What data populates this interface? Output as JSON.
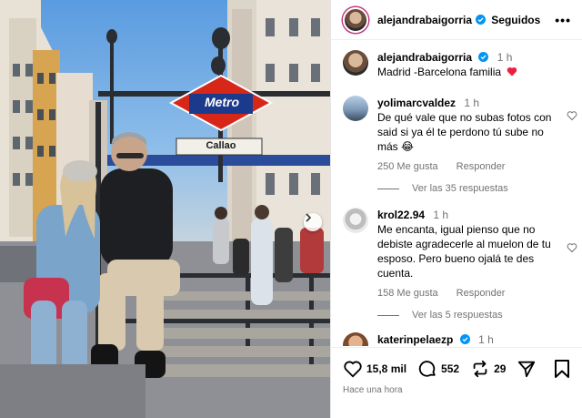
{
  "post": {
    "photo_alt_signs": {
      "metro": "Metro",
      "station": "Callao"
    }
  },
  "header": {
    "username": "alejandrabaigorria",
    "follow_label": "Seguidos",
    "more_label": "•••"
  },
  "caption": {
    "username": "alejandrabaigorria",
    "time": "1 h",
    "text": "Madrid -Barcelona  familia"
  },
  "comments": [
    {
      "username": "yolimarcvaldez",
      "time": "1 h",
      "text": "De qué vale que no subas fotos con said si ya él te perdono tú sube no más 😂",
      "likes": "250 Me gusta",
      "reply": "Responder",
      "replies": "Ver las 35 respuestas"
    },
    {
      "username": "krol22.94",
      "time": "1 h",
      "text": "Me encanta, igual pienso que no debiste agradecerle al muelon de tu esposo. Pero bueno ojalá te des cuenta.",
      "likes": "158 Me gusta",
      "reply": "Responder",
      "replies": "Ver las 5 respuestas"
    },
    {
      "username": "katerinpelaezp",
      "time": "1 h"
    }
  ],
  "actions": {
    "likes": "15,8 mil",
    "comments": "552",
    "reposts": "29",
    "posted_ago": "Hace una hora"
  },
  "colors": {
    "verified": "#0095f6",
    "heart_red": "#ed1f3e",
    "metro_red": "#d62718",
    "metro_blue": "#1b3a8c"
  }
}
